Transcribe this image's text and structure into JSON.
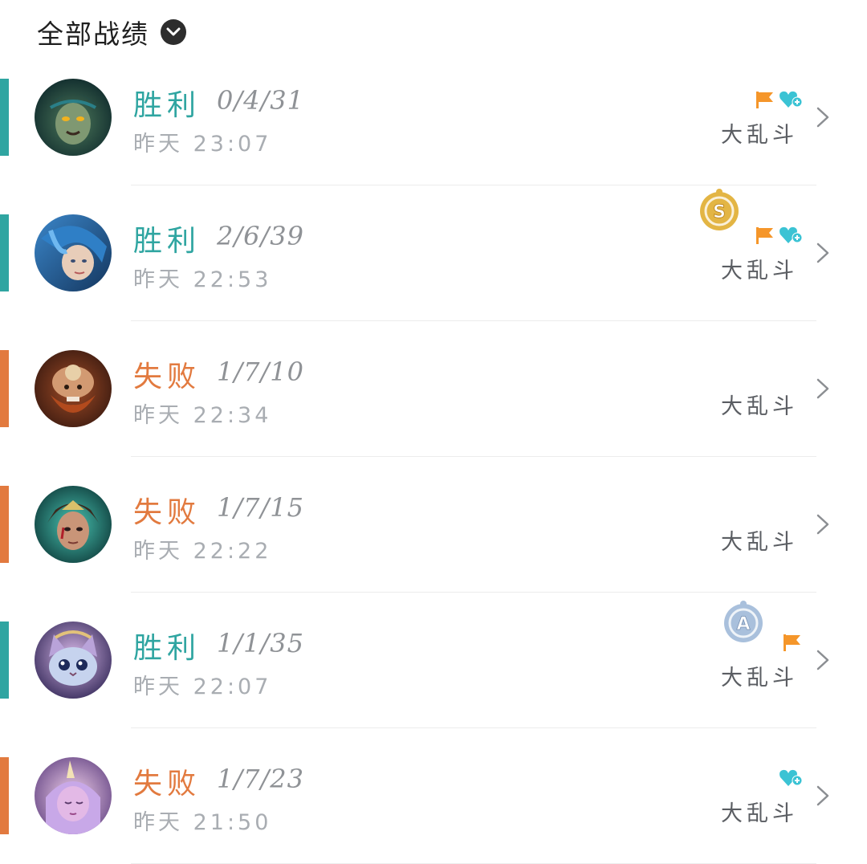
{
  "header": {
    "title": "全部战绩",
    "toggle_icon": "chevron-down-circle-icon"
  },
  "colors": {
    "win": "#2fa5a1",
    "lose": "#e27a3f",
    "flag": "#f5962a",
    "heart": "#3bc3d4",
    "gold_medal": "#e3b544",
    "silver_medal": "#a9c0dc"
  },
  "matches": [
    {
      "result": "胜利",
      "outcome": "win",
      "kda": "0/4/31",
      "time": "昨天 23:07",
      "mode": "大乱斗",
      "champion_icon": "champion-amumu-avatar",
      "badges": [
        "flag-icon",
        "heart-plus-icon"
      ],
      "medal": null
    },
    {
      "result": "胜利",
      "outcome": "win",
      "kda": "2/6/39",
      "time": "昨天 22:53",
      "mode": "大乱斗",
      "champion_icon": "champion-gwen-avatar",
      "badges": [
        "flag-icon",
        "heart-plus-icon"
      ],
      "medal": {
        "icon": "gold-s-medal-icon",
        "letter": "S"
      }
    },
    {
      "result": "失败",
      "outcome": "lose",
      "kda": "1/7/10",
      "time": "昨天 22:34",
      "mode": "大乱斗",
      "champion_icon": "champion-gragas-avatar",
      "badges": [],
      "medal": null
    },
    {
      "result": "失败",
      "outcome": "lose",
      "kda": "1/7/15",
      "time": "昨天 22:22",
      "mode": "大乱斗",
      "champion_icon": "champion-akali-avatar",
      "badges": [],
      "medal": null
    },
    {
      "result": "胜利",
      "outcome": "win",
      "kda": "1/1/35",
      "time": "昨天 22:07",
      "mode": "大乱斗",
      "champion_icon": "champion-yuumi-avatar",
      "badges": [
        "flag-icon"
      ],
      "medal": {
        "icon": "silver-a-medal-icon",
        "letter": "A"
      }
    },
    {
      "result": "失败",
      "outcome": "lose",
      "kda": "1/7/23",
      "time": "昨天 21:50",
      "mode": "大乱斗",
      "champion_icon": "champion-soraka-avatar",
      "badges": [
        "heart-plus-icon"
      ],
      "medal": null
    }
  ]
}
